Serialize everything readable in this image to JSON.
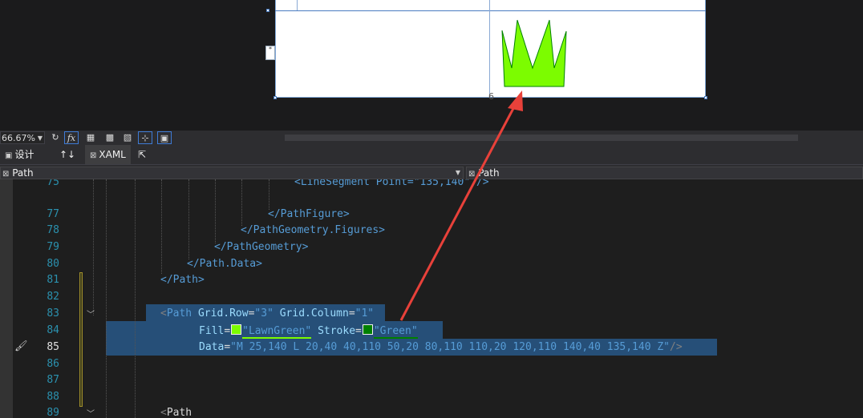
{
  "designer": {
    "margin_tag": "*",
    "shape_fill": "#7CFC00",
    "shape_stroke": "#008000"
  },
  "toolbar": {
    "zoom_value": "66.67%",
    "refresh_icon": "refresh-icon",
    "fx_label": "fx"
  },
  "tabs": {
    "design_label": "设计",
    "swap_icon": "↑↓",
    "xaml_label": "XAML"
  },
  "navbar": {
    "left_combo": "Path",
    "right_combo": "Path"
  },
  "editor": {
    "lines": [
      {
        "n": "75"
      },
      {
        "n": "77"
      },
      {
        "n": "78"
      },
      {
        "n": "79"
      },
      {
        "n": "80"
      },
      {
        "n": "81"
      },
      {
        "n": "82"
      },
      {
        "n": "83"
      },
      {
        "n": "84"
      },
      {
        "n": "85"
      },
      {
        "n": "86"
      },
      {
        "n": "87"
      },
      {
        "n": "88"
      },
      {
        "n": "89"
      }
    ],
    "code": {
      "l75": "<LineSegment Point=\"135,140\" />",
      "l77": "</PathFigure>",
      "l78": "</PathGeometry.Figures>",
      "l79": "</PathGeometry>",
      "l80": "</Path.Data>",
      "l81": "</Path>",
      "l83_tag": "Path",
      "l83_attr1": "Grid.Row",
      "l83_val1": "\"3\"",
      "l83_attr2": "Grid.Column",
      "l83_val2": "\"1\"",
      "l84_attr1": "Fill",
      "l84_val1": "\"LawnGreen\"",
      "l84_attr2": "Stroke",
      "l84_val2": "\"Green\"",
      "l85_attr": "Data",
      "l85_val": "\"M 25,140 L 20,40 40,110 50,20 80,110 110,20 120,110 140,40 135,140 Z\"",
      "l85_end": "/>",
      "l89_tag": "Path"
    }
  }
}
